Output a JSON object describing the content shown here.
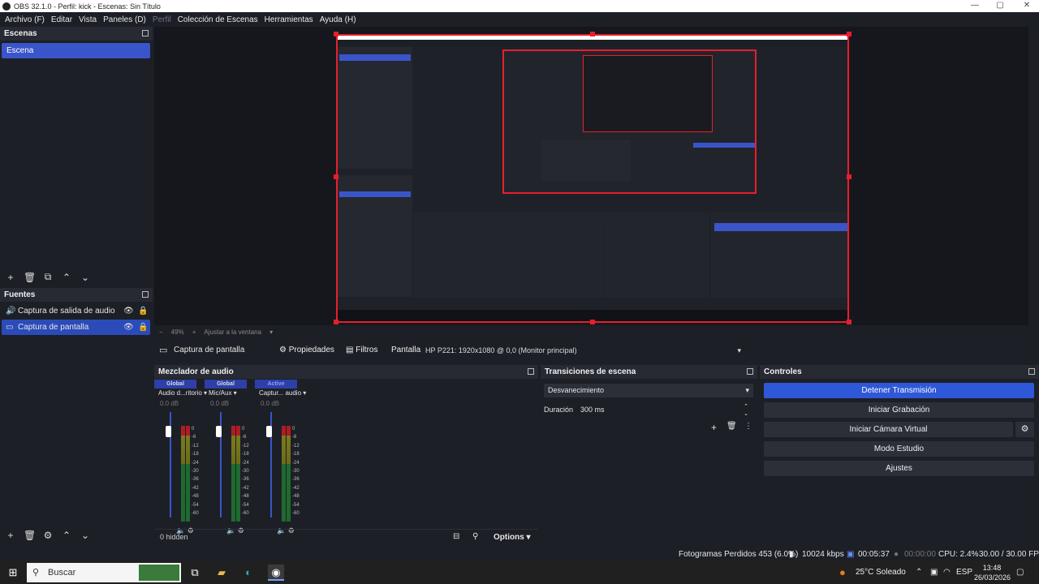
{
  "window": {
    "title": "OBS 32.1.0 - Perfil: kick - Escenas: Sin Título",
    "controls": [
      "—",
      "▢",
      "✕"
    ]
  },
  "menu": [
    {
      "label": "Archivo (F)",
      "dim": false
    },
    {
      "label": "Editar",
      "dim": false
    },
    {
      "label": "Vista",
      "dim": false
    },
    {
      "label": "Paneles (D)",
      "dim": false
    },
    {
      "label": "Perfil",
      "dim": true
    },
    {
      "label": "Colección de Escenas",
      "dim": false
    },
    {
      "label": "Herramientas",
      "dim": false
    },
    {
      "label": "Ayuda (H)",
      "dim": false
    }
  ],
  "scenes": {
    "title": "Escenas",
    "items": [
      "Escena"
    ]
  },
  "sources": {
    "title": "Fuentes",
    "items": [
      {
        "label": "Captura de salida de audio",
        "icon": "speaker-icon"
      },
      {
        "label": "Captura de pantalla",
        "icon": "monitor-icon"
      }
    ]
  },
  "zoom": {
    "percent": "49%",
    "fit_label": "Ajustar a la ventana"
  },
  "source_bar": {
    "source_name": "Captura de pantalla",
    "properties_label": "Propiedades",
    "filters_label": "Filtros",
    "display_label": "Pantalla",
    "display_value": "HP P221: 1920x1080 @ 0,0 (Monitor principal)"
  },
  "mixer": {
    "title": "Mezclador de audio",
    "channels": [
      {
        "header": "Global",
        "name": "Audio d...ritorio",
        "db": "0.0 dB"
      },
      {
        "header": "Global",
        "name": "Mic/Aux",
        "db": "0.0 dB"
      },
      {
        "header": "Active",
        "name": "Captur... audio",
        "db": "0.0 dB"
      }
    ],
    "ticks": [
      "0",
      "-6",
      "-12",
      "-18",
      "-24",
      "-30",
      "-36",
      "-42",
      "-48",
      "-54",
      "-60"
    ],
    "hidden_label": "0 hidden",
    "options_label": "Options"
  },
  "transitions": {
    "title": "Transiciones de escena",
    "selected": "Desvanecimiento",
    "duration_label": "Duración",
    "duration_value": "300 ms"
  },
  "controls": {
    "title": "Controles",
    "buttons": [
      "Detener Transmisión",
      "Iniciar Grabación",
      "Iniciar Cámara Virtual",
      "Modo Estudio",
      "Ajustes"
    ]
  },
  "status": {
    "dropped": "Fotogramas Perdidos 453 (6.0%)",
    "bitrate": "10024 kbps",
    "stream_time": "00:05:37",
    "rec_time": "00:00:00",
    "cpu": "CPU: 2.4%",
    "fps": "30.00 / 30.00 FPS"
  },
  "taskbar": {
    "search_placeholder": "Buscar",
    "weather": "25°C  Soleado",
    "lang": "ESP",
    "time": "13:48",
    "date": "26/03/2026"
  },
  "colors": {
    "accent": "#3a55c9",
    "primary_button": "#2f58d8",
    "preview_border": "#e81e2d",
    "background": "#1d1f26"
  }
}
